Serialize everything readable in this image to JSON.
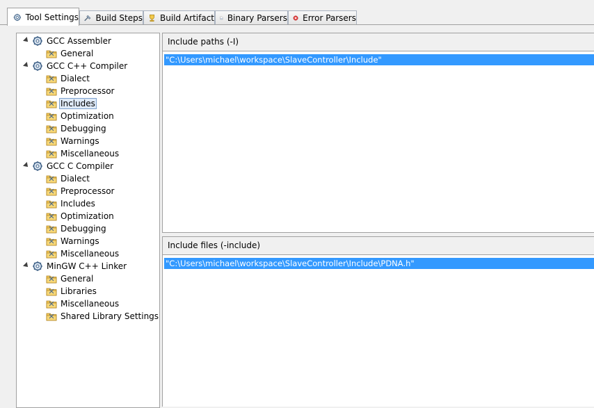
{
  "tabs": [
    {
      "label": "Tool Settings",
      "icon": "tool-settings-icon",
      "active": true
    },
    {
      "label": "Build Steps",
      "icon": "build-steps-icon"
    },
    {
      "label": "Build Artifact",
      "icon": "build-artifact-icon"
    },
    {
      "label": "Binary Parsers",
      "icon": "binary-parsers-icon"
    },
    {
      "label": "Error Parsers",
      "icon": "error-parsers-icon"
    }
  ],
  "tree": {
    "groups": [
      {
        "label": "GCC Assembler",
        "icon": "tool-gear-icon",
        "children": [
          "General"
        ]
      },
      {
        "label": "GCC C++ Compiler",
        "icon": "tool-gear-icon",
        "children": [
          "Dialect",
          "Preprocessor",
          "Includes",
          "Optimization",
          "Debugging",
          "Warnings",
          "Miscellaneous"
        ]
      },
      {
        "label": "GCC C Compiler",
        "icon": "tool-gear-icon",
        "children": [
          "Dialect",
          "Preprocessor",
          "Includes",
          "Optimization",
          "Debugging",
          "Warnings",
          "Miscellaneous"
        ]
      },
      {
        "label": "MinGW C++ Linker",
        "icon": "tool-gear-icon",
        "children": [
          "General",
          "Libraries",
          "Miscellaneous",
          "Shared Library Settings"
        ]
      }
    ],
    "selected": "GCC C++ Compiler / Includes"
  },
  "include_paths": {
    "header": "Include paths (-I)",
    "items": [
      "\"C:\\Users\\michael\\workspace\\SlaveController\\Include\""
    ]
  },
  "include_files": {
    "header": "Include files (-include)",
    "items": [
      "\"C:\\Users\\michael\\workspace\\SlaveController\\Include\\PDNA.h\""
    ]
  },
  "colors": {
    "selection": "#3399ff",
    "tree_selection": "#dfeaf8"
  }
}
